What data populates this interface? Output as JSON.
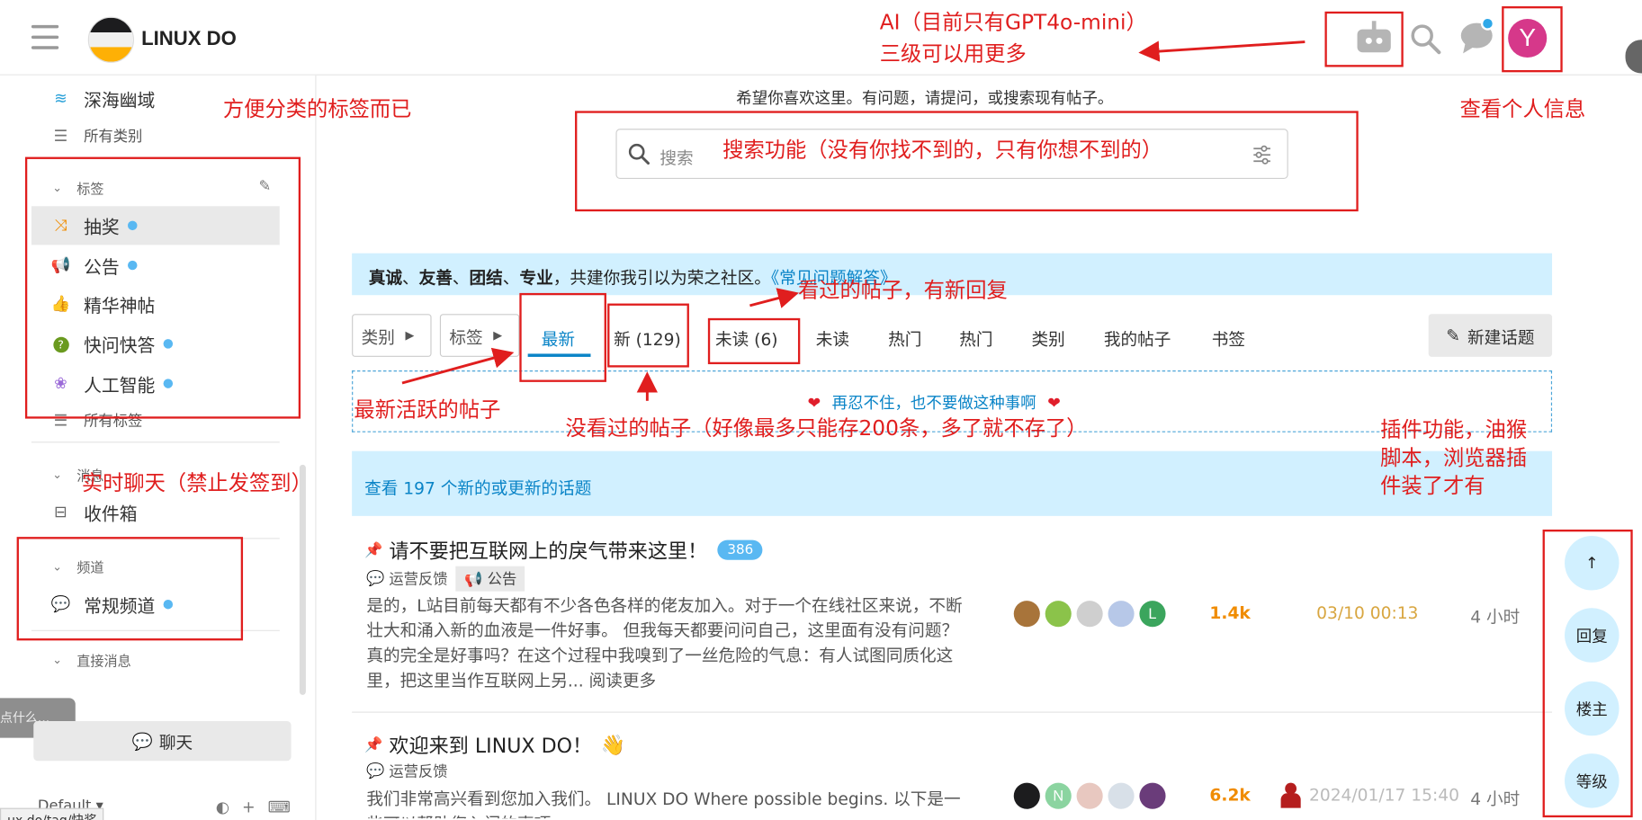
{
  "header": {
    "site_name": "LINUX DO",
    "avatar_letter": "Y",
    "avatar_color": "#d6388a",
    "icons": [
      "robot-icon",
      "search-icon",
      "chat-icon"
    ]
  },
  "sidebar": {
    "top_items": [
      {
        "label": "深海幽域",
        "icon": "waves-icon"
      },
      {
        "label": "所有类别",
        "icon": "list-icon"
      }
    ],
    "tags_header": "标签",
    "tags": [
      {
        "label": "抽奖",
        "icon": "shuffle-icon",
        "dot": true
      },
      {
        "label": "公告",
        "icon": "megaphone-icon",
        "dot": true
      },
      {
        "label": "精华神帖",
        "icon": "thumbs-up-icon",
        "dot": false
      },
      {
        "label": "快问快答",
        "icon": "question-icon",
        "dot": true
      },
      {
        "label": "人工智能",
        "icon": "brain-icon",
        "dot": true
      }
    ],
    "all_tags": "所有标签",
    "messages_header": "消息",
    "inbox": "收件箱",
    "channels_header": "频道",
    "channel": "常规频道",
    "dm_header": "直接消息",
    "chat_button": "聊天",
    "tooltip": "点什么...",
    "theme": "Default",
    "url_hint": "ux.do/tag/快奖"
  },
  "main": {
    "welcome": "希望你喜欢这里。有问题，请提问，或搜索现有帖子。",
    "search_placeholder": "搜索",
    "banner": {
      "b1": "真诚",
      "s1": "、",
      "b2": "友善",
      "s2": "、",
      "b3": "团结",
      "s3": "、",
      "b4": "专业",
      "text": "，共建你我引以为荣之社区。",
      "link": "《常见问题解答》"
    },
    "nav": {
      "category_btn": "类别",
      "tags_btn": "标签",
      "tabs": [
        "最新",
        "新 (129)",
        "未读 (6)",
        "未读",
        "热门",
        "热门",
        "类别",
        "我的帖子",
        "书签"
      ],
      "new_topic": "新建话题"
    },
    "notice": "再忍不住，也不要做这种事啊",
    "new_topics": "查看 197 个新的或更新的话题",
    "topics": [
      {
        "title": "请不要把互联网上的戾气带来这里！",
        "replies": "386",
        "category": "运营反馈",
        "tag": "公告",
        "excerpt": "是的，L站目前每天都有不少各色各样的佬友加入。对于一个在线社区来说，不断壮大和涌入新的血液是一件好事。 但我每天都要问问自己，这里面有没有问题？真的完全是好事吗？在这个过程中我嗅到了一丝危险的气息：有人试图同质化这里，把这里当作互联网上另... 阅读更多",
        "views": "1.4k",
        "date": "03/10 00:13",
        "age": "4 小时",
        "posters": [
          {
            "letter": "",
            "color": "#a8743a"
          },
          {
            "letter": "",
            "color": "#8bc34a"
          },
          {
            "letter": "",
            "color": "#cfcfcf"
          },
          {
            "letter": "",
            "color": "#b7c8e8"
          },
          {
            "letter": "L",
            "color": "#3ba55d"
          }
        ]
      },
      {
        "title": "欢迎来到 LINUX DO！",
        "category": "运营反馈",
        "excerpt": "我们非常高兴看到您加入我们。 LINUX DO Where possible begins. 以下是一些可以帮助您入门的事项。",
        "views": "6.2k",
        "date": "2024/01/17 15:40",
        "age": "4 小时",
        "posters": [
          {
            "letter": "",
            "color": "#1c1c1e"
          },
          {
            "letter": "N",
            "color": "#8bd4a0"
          },
          {
            "letter": "",
            "color": "#e8c8c0"
          },
          {
            "letter": "",
            "color": "#d8e0e8"
          },
          {
            "letter": "",
            "color": "#6a3c7a"
          }
        ]
      }
    ],
    "fabs": [
      "↑",
      "回复",
      "楼主",
      "等级"
    ]
  },
  "annotations": {
    "ai": "AI（目前只有GPT4o-mini）",
    "ai2": "三级可以用更多",
    "profile": "查看个人信息",
    "tags": "方便分类的标签而已",
    "search": "搜索功能（没有你找不到的，只有你想不到的）",
    "seen": "看过的帖子，有新回复",
    "latest": "最新活跃的帖子",
    "unseen": "没看过的帖子（好像最多只能存200条，多了就不存了）",
    "chat": "实时聊天（禁止发签到）",
    "plugin": "插件功能，油猴脚本，浏览器插件装了才有",
    "color": "#e01e1e"
  }
}
